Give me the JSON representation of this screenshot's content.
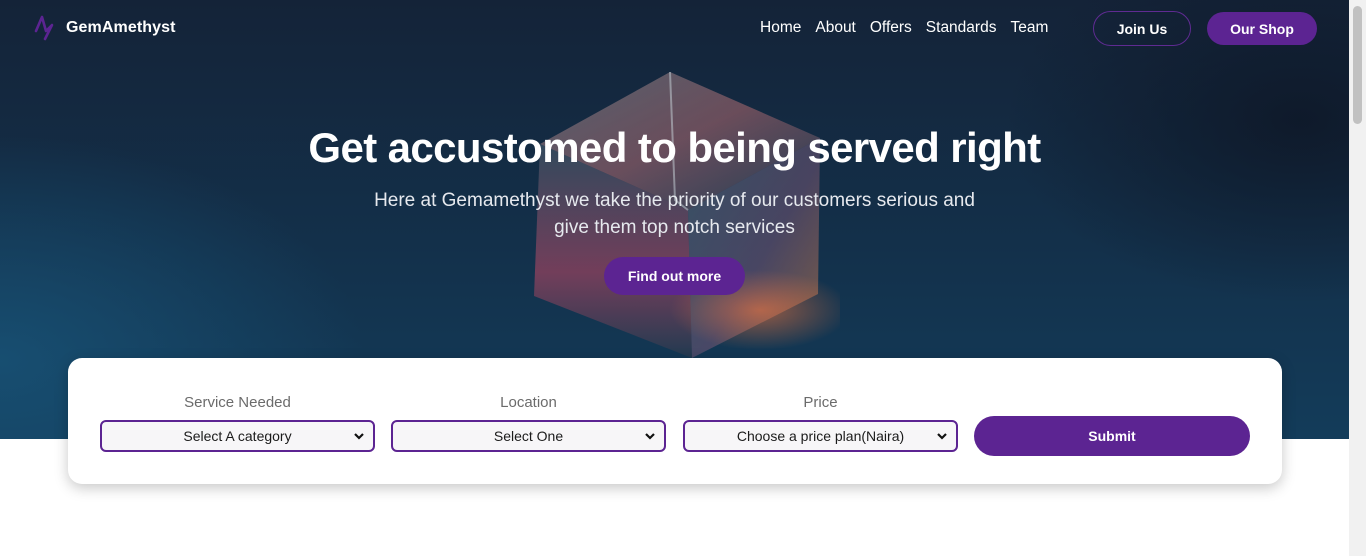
{
  "brand": {
    "name": "GemAmethyst",
    "logo_icon": "bolt-logo-icon"
  },
  "nav": {
    "links": [
      "Home",
      "About",
      "Offers",
      "Standards",
      "Team"
    ],
    "join_label": "Join Us",
    "shop_label": "Our Shop"
  },
  "hero": {
    "headline": "Get accustomed to being served right",
    "subline": "Here at Gemamethyst we take the priority of our customers serious and give them top notch services",
    "cta_label": "Find out more"
  },
  "search_form": {
    "service": {
      "label": "Service Needed",
      "selected": "Select A category"
    },
    "location": {
      "label": "Location",
      "selected": "Select One"
    },
    "price": {
      "label": "Price",
      "selected": "Choose a price plan(Naira)"
    },
    "submit_label": "Submit"
  },
  "colors": {
    "accent": "#5c2492",
    "hero_dark": "#142338",
    "hero_blue": "#133c5a"
  }
}
